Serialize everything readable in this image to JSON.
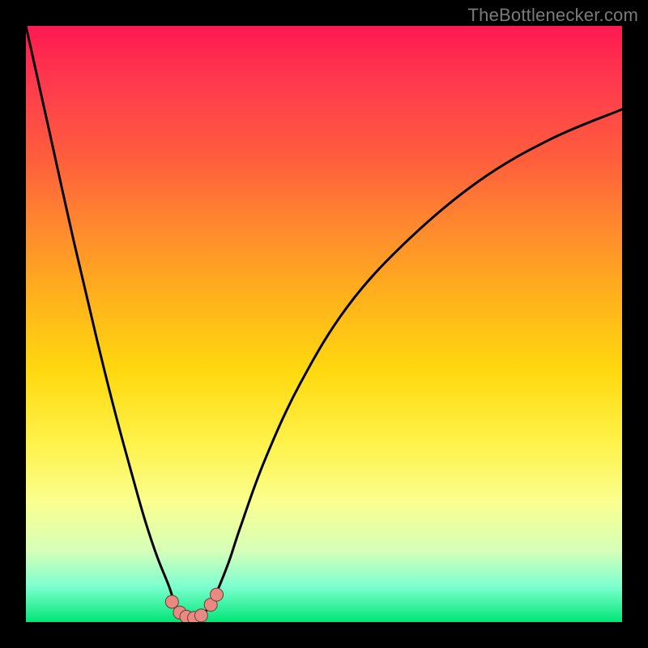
{
  "attribution": "TheBottlenecker.com",
  "colors": {
    "frame": "#000000",
    "curve_stroke": "#000000",
    "marker_fill": "#e98a82",
    "marker_stroke": "#6b3a36",
    "gradient_top": "#ff1a52",
    "gradient_bottom": "#00e676"
  },
  "chart_data": {
    "type": "line",
    "title": "",
    "xlabel": "",
    "ylabel": "",
    "xlim": [
      0,
      100
    ],
    "ylim": [
      0,
      100
    ],
    "series": [
      {
        "name": "bottleneck-curve",
        "x": [
          0,
          4,
          8,
          12,
          15,
          18,
          20,
          22,
          24,
          25,
          26,
          27,
          28,
          29,
          30,
          31,
          32,
          34,
          36,
          40,
          46,
          54,
          64,
          76,
          88,
          100
        ],
        "values": [
          100,
          82,
          64,
          47,
          35,
          24,
          17,
          11,
          6,
          3,
          1.5,
          0.8,
          0.5,
          0.8,
          1.6,
          3,
          5,
          10,
          16,
          27,
          40,
          53,
          64,
          74,
          81,
          86
        ]
      }
    ],
    "scatter_points": [
      {
        "x": 24.5,
        "y": 3.4
      },
      {
        "x": 25.8,
        "y": 1.6
      },
      {
        "x": 26.9,
        "y": 0.9
      },
      {
        "x": 28.2,
        "y": 0.7
      },
      {
        "x": 29.4,
        "y": 1.1
      },
      {
        "x": 31.0,
        "y": 2.9
      },
      {
        "x": 32.0,
        "y": 4.6
      }
    ],
    "notes": "Axes are unlabeled in the image; x and values scaled 0–100 to the visible plot area. Curve is a deep V with minimum near x≈28 and the right branch approaching ~86% by the right edge."
  }
}
